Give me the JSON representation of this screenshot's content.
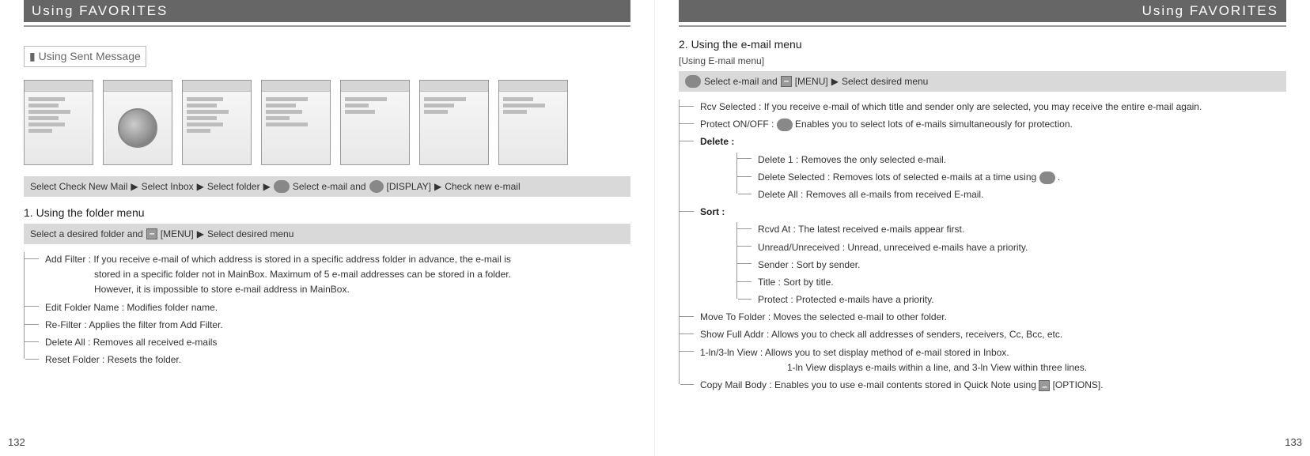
{
  "header": {
    "title_left": "Using FAVORITES",
    "title_right": "Using FAVORITES"
  },
  "left": {
    "section_head": "▮ Using Sent Message",
    "strip1": {
      "p1": "Select Check New Mail",
      "p2": "Select Inbox",
      "p3": "Select folder",
      "p4": "Select e-mail and",
      "p5_label": "[DISPLAY]",
      "p6": "Check new e-mail"
    },
    "sub_h": "1. Using the folder menu",
    "strip2": {
      "p1": "Select a desired folder and",
      "p2_label": "[MENU]",
      "p3": "Select desired menu"
    },
    "tree": {
      "add_filter": "Add Filter : If you receive e-mail of which address is stored in a specific address folder in advance, the e-mail is",
      "add_filter_l2": "stored in a specific folder not in MainBox. Maximum of 5 e-mail addresses can be stored in a folder.",
      "add_filter_l3": "However, it is impossible to store e-mail address in MainBox.",
      "edit_folder": "Edit Folder Name : Modifies folder name.",
      "refilter": "Re-Filter : Applies the filter from Add Filter.",
      "delete_all": "Delete All : Removes all received e-mails",
      "reset_folder": "Reset Folder : Resets the folder."
    },
    "page_num": "132"
  },
  "right": {
    "sub_h": "2. Using the e-mail menu",
    "bracket": "[Using E-mail menu]",
    "strip": {
      "p1": "Select e-mail and",
      "p2_label": "[MENU]",
      "p3": "Select desired menu"
    },
    "tree": {
      "rcv_selected": "Rcv Selected : If you receive e-mail of which title and sender only are selected, you may receive the entire e-mail again.",
      "protect_onoff_pre": "Protect ON/OFF : ",
      "protect_onoff_post": " Enables you to select lots of e-mails simultaneously for protection.",
      "delete_label": "Delete :",
      "delete_1": "Delete 1 : Removes the only selected e-mail.",
      "delete_selected_pre": "Delete Selected : Removes lots of selected e-mails at a time using ",
      "delete_selected_post": ".",
      "delete_all": "Delete All : Removes all e-mails from received E-mail.",
      "sort_label": "Sort :",
      "sort_rcvd": "Rcvd At : The latest received e-mails appear first.",
      "sort_unread": "Unread/Unreceived : Unread, unreceived e-mails have a priority.",
      "sort_sender": "Sender : Sort by sender.",
      "sort_title": "Title : Sort by title.",
      "sort_protect": "Protect : Protected e-mails have a priority.",
      "move_folder": "Move To Folder : Moves the selected e-mail to other folder.",
      "show_addr": "Show Full Addr : Allows you to check all addresses of senders, receivers, Cc, Bcc, etc.",
      "view_mode": "1-ln/3-ln View : Allows you to set display method of e-mail stored in Inbox.",
      "view_mode_l2": "1-ln View displays e-mails within a line, and 3-ln View within three lines.",
      "copy_body_pre": "Copy Mail Body : Enables you to use e-mail contents stored in Quick Note using ",
      "copy_body_post": "[OPTIONS]."
    },
    "page_num": "133"
  }
}
